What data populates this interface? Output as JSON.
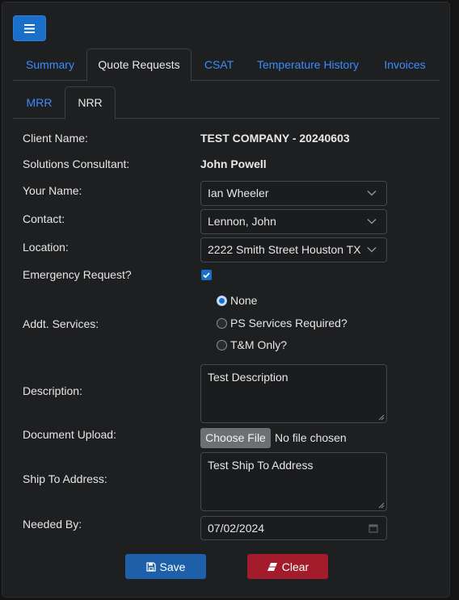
{
  "colors": {
    "accent": "#1a6fc9",
    "link": "#3d8bfd",
    "danger": "#a21c2b",
    "save": "#1d5fa8"
  },
  "toolbar": {
    "menu_icon": "hamburger-icon"
  },
  "tabs": [
    {
      "label": "Summary",
      "active": false
    },
    {
      "label": "Quote Requests",
      "active": true
    },
    {
      "label": "CSAT",
      "active": false
    },
    {
      "label": "Temperature History",
      "active": false
    },
    {
      "label": "Invoices",
      "active": false
    }
  ],
  "subtabs": [
    {
      "label": "MRR",
      "active": false
    },
    {
      "label": "NRR",
      "active": true
    }
  ],
  "form": {
    "client_name": {
      "label": "Client Name:",
      "value": "TEST COMPANY - 20240603"
    },
    "solutions_consultant": {
      "label": "Solutions Consultant:",
      "value": "John Powell"
    },
    "your_name": {
      "label": "Your Name:",
      "value": "Ian Wheeler"
    },
    "contact": {
      "label": "Contact:",
      "value": "Lennon, John"
    },
    "location": {
      "label": "Location:",
      "value": "2222 Smith Street Houston TX"
    },
    "emergency": {
      "label": "Emergency Request?",
      "checked": true
    },
    "services": {
      "label": "Addt. Services:",
      "options": [
        "None",
        "PS Services Required?",
        "T&M Only?"
      ],
      "selected": "None"
    },
    "description": {
      "label": "Description:",
      "value": "Test Description"
    },
    "document": {
      "label": "Document Upload:",
      "button": "Choose File",
      "status": "No file chosen"
    },
    "ship_to": {
      "label": "Ship To Address:",
      "value": "Test Ship To Address"
    },
    "needed_by": {
      "label": "Needed By:",
      "value": "07/02/2024"
    }
  },
  "actions": {
    "save": "Save",
    "clear": "Clear"
  }
}
